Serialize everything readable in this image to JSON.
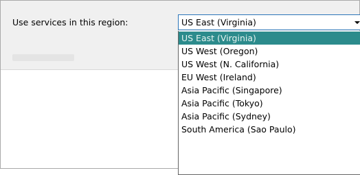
{
  "form": {
    "region_label": "Use services in this region:"
  },
  "region_select": {
    "selected_value": "US East (Virginia)",
    "options": [
      {
        "label": "US East (Virginia)",
        "selected": true
      },
      {
        "label": "US West (Oregon)",
        "selected": false
      },
      {
        "label": "US West (N. California)",
        "selected": false
      },
      {
        "label": "EU West (Ireland)",
        "selected": false
      },
      {
        "label": "Asia Pacific (Singapore)",
        "selected": false
      },
      {
        "label": "Asia Pacific (Tokyo)",
        "selected": false
      },
      {
        "label": "Asia Pacific (Sydney)",
        "selected": false
      },
      {
        "label": "South America (Sao Paulo)",
        "selected": false
      }
    ]
  },
  "colors": {
    "selection_background": "#2c8b8c",
    "selection_text": "#e6f4f1",
    "focus_border": "#2a74b8",
    "panel_background": "#f0f0f0"
  },
  "icons": {
    "dropdown_arrow": "chevron-down-icon"
  }
}
